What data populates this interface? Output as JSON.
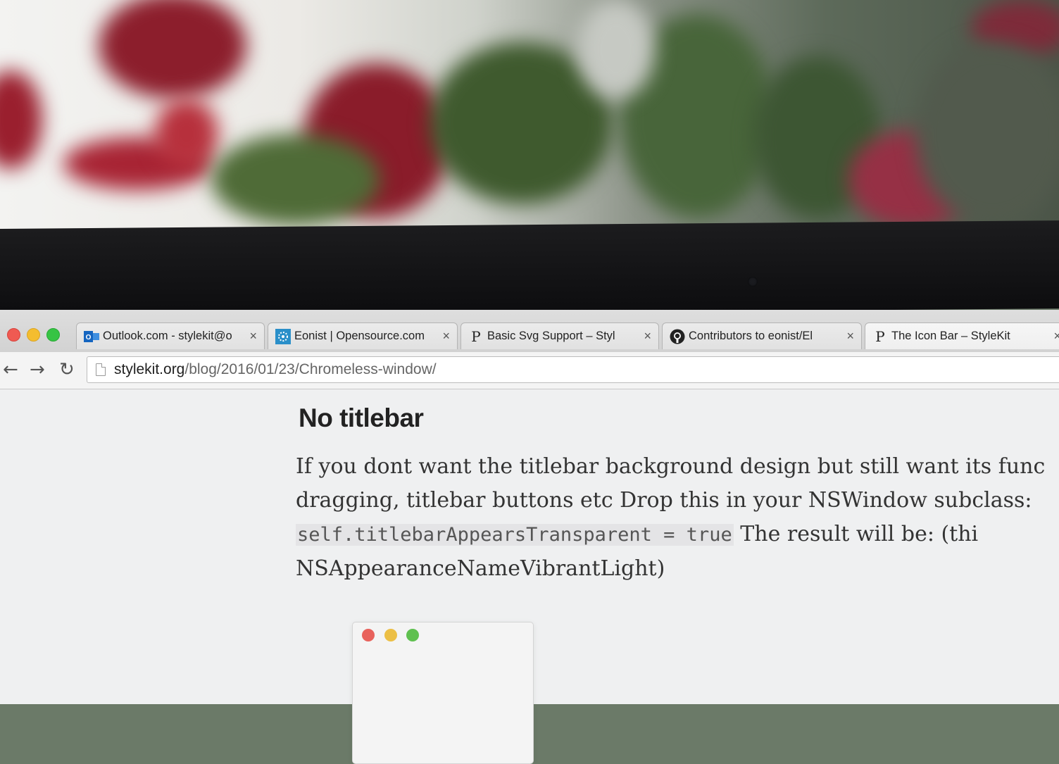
{
  "browser": {
    "tabs": [
      {
        "title": "Outlook.com - stylekit@o",
        "favicon": "outlook-icon",
        "close": "×"
      },
      {
        "title": "Eonist | Opensource.com",
        "favicon": "opensource-icon",
        "close": "×"
      },
      {
        "title": "Basic Svg Support – Styl",
        "favicon": "p-letter-icon",
        "favicon_text": "P",
        "close": "×"
      },
      {
        "title": "Contributors to eonist/El",
        "favicon": "github-icon",
        "close": "×"
      },
      {
        "title": "The Icon Bar – StyleKit",
        "favicon": "p-letter-icon",
        "favicon_text": "P",
        "close": "×"
      }
    ],
    "nav": {
      "back": "←",
      "forward": "→",
      "reload": "↻"
    },
    "address": {
      "host": "stylekit.org",
      "path": "/blog/2016/01/23/Chromeless-window/"
    }
  },
  "article": {
    "heading": "No titlebar",
    "line1": "If you dont want the titlebar background design but still want its func",
    "line2": "dragging, titlebar buttons etc Drop this in your NSWindow subclass:",
    "code": "self.titlebarAppearsTransparent = true",
    "line3_rest": " The result will be: (thi",
    "line4": "NSAppearanceNameVibrantLight)"
  },
  "colors": {
    "close": "#ef5a52",
    "minimize": "#f4bd2f",
    "zoom": "#37c444",
    "demo_close": "#e8625c",
    "demo_minimize": "#ecbf45",
    "demo_zoom": "#5fc04f"
  }
}
